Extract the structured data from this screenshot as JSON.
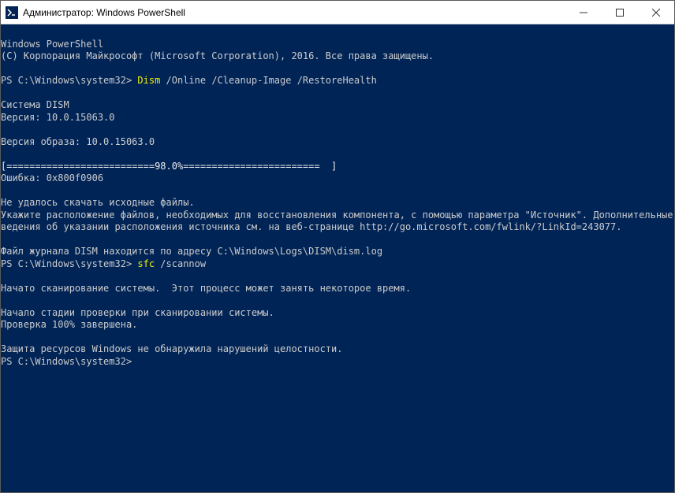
{
  "window": {
    "title": "Администратор: Windows PowerShell"
  },
  "terminal": {
    "header1": "Windows PowerShell",
    "header2": "(C) Корпорация Майкрософт (Microsoft Corporation), 2016. Все права защищены.",
    "prompt1_prefix": "PS C:\\Windows\\system32> ",
    "prompt1_cmd": "Dism",
    "prompt1_args": " /Online /Cleanup-Image /RestoreHealth",
    "dism_system": "Cистема DISM",
    "dism_version": "Версия: 10.0.15063.0",
    "image_version": "Версия образа: 10.0.15063.0",
    "progress": "[==========================98.0%========================  ]",
    "error": "Ошибка: 0x800f0906",
    "err_line1": "Не удалось скачать исходные файлы.",
    "err_line2": "Укажите расположение файлов, необходимых для восстановления компонента, с помощью параметра \"Источник\". Дополнительные с",
    "err_line3": "ведения об указании расположения источника см. на веб-странице http://go.microsoft.com/fwlink/?LinkId=243077.",
    "log_line": "Файл журнала DISM находится по адресу C:\\Windows\\Logs\\DISM\\dism.log",
    "prompt2_prefix": "PS C:\\Windows\\system32> ",
    "prompt2_cmd": "sfc",
    "prompt2_args": " /scannow",
    "scan_started": "Начато сканирование системы.  Этот процесс может занять некоторое время.",
    "scan_phase": "Начало стадии проверки при сканировании системы.",
    "scan_complete": "Проверка 100% завершена.",
    "scan_result": "Защита ресурсов Windows не обнаружила нарушений целостности.",
    "prompt3": "PS C:\\Windows\\system32>"
  }
}
